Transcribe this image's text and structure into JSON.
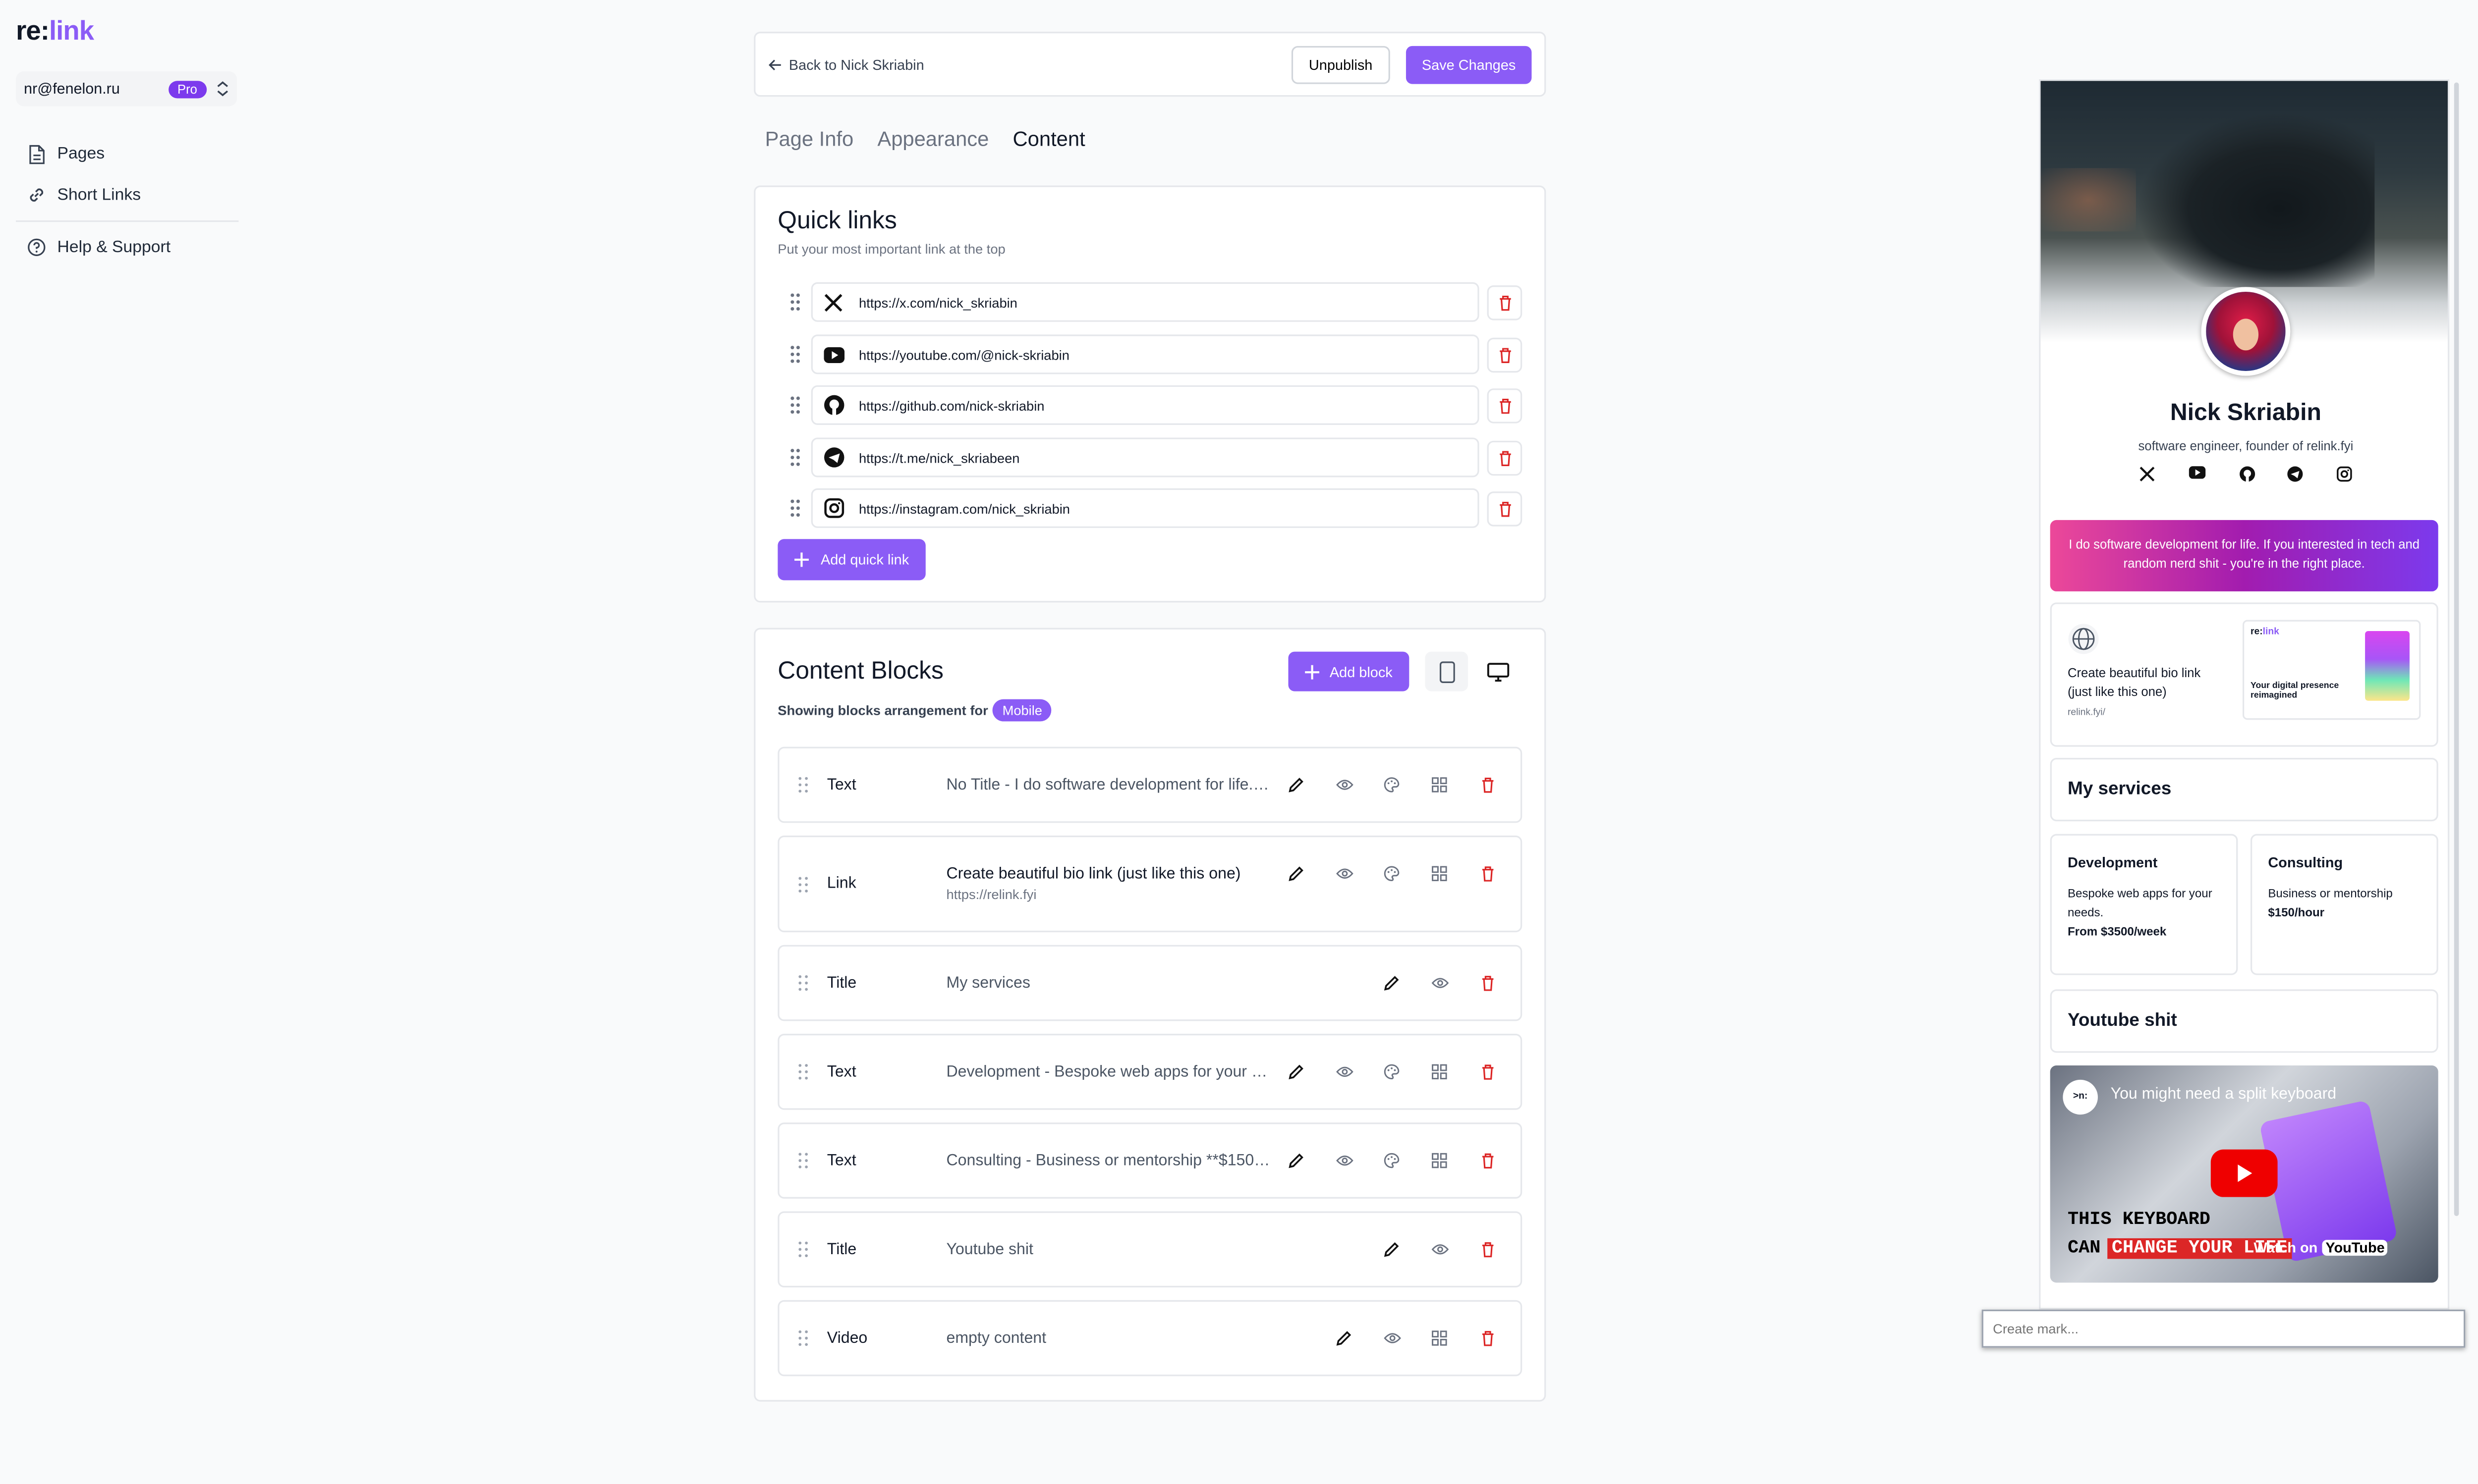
{
  "brand": {
    "re": "re:",
    "link": "link"
  },
  "account": {
    "email": "nr@fenelon.ru",
    "plan": "Pro"
  },
  "sidebar": {
    "items": [
      {
        "label": "Pages",
        "icon": "file-icon"
      },
      {
        "label": "Short Links",
        "icon": "link-icon"
      },
      {
        "label": "Help & Support",
        "icon": "help-circle-icon"
      }
    ]
  },
  "topbar": {
    "back_label": "Back to Nick Skriabin",
    "unpublish_label": "Unpublish",
    "save_label": "Save Changes"
  },
  "tabs": [
    {
      "label": "Page Info",
      "active": false
    },
    {
      "label": "Appearance",
      "active": false
    },
    {
      "label": "Content",
      "active": true
    }
  ],
  "quick_links": {
    "title": "Quick links",
    "subtitle": "Put your most important link at the top",
    "items": [
      {
        "icon": "x-icon",
        "url": "https://x.com/nick_skriabin"
      },
      {
        "icon": "youtube-icon",
        "url": "https://youtube.com/@nick-skriabin"
      },
      {
        "icon": "github-icon",
        "url": "https://github.com/nick-skriabin"
      },
      {
        "icon": "telegram-icon",
        "url": "https://t.me/nick_skriabeen"
      },
      {
        "icon": "instagram-icon",
        "url": "https://instagram.com/nick_skriabin"
      }
    ],
    "add_label": "Add quick link"
  },
  "content_blocks": {
    "title": "Content Blocks",
    "subtitle": "Showing blocks arrangement for",
    "mode": "Mobile",
    "add_label": "Add block",
    "blocks": [
      {
        "type": "Text",
        "description": "No Title - I do software development for life. If you interested in tech and random nerd shit - you're in the right place."
      },
      {
        "type": "Link",
        "description": "Create beautiful bio link (just like this one)",
        "url": "https://relink.fyi"
      },
      {
        "type": "Title",
        "description": "My services"
      },
      {
        "type": "Text",
        "description": "Development - Bespoke web apps for your needs."
      },
      {
        "type": "Text",
        "description": "Consulting - Business or mentorship **$150/hour**"
      },
      {
        "type": "Title",
        "description": "Youtube shit"
      },
      {
        "type": "Video",
        "description": "empty content"
      }
    ]
  },
  "preview": {
    "name": "Nick Skriabin",
    "bio": "software engineer, founder of relink.fyi",
    "banner_text": "I do software development for life. If you interested in tech and random nerd shit - you're in the right place.",
    "link_card": {
      "title": "Create beautiful bio link (just like this one)",
      "url": "relink.fyi/",
      "thumb_logo_re": "re:",
      "thumb_logo_link": "link",
      "thumb_tagline": "Your digital presence reimagined"
    },
    "services_title": "My services",
    "services": [
      {
        "title": "Development",
        "desc": "Bespoke web apps for your needs.",
        "price": "From $3500/week"
      },
      {
        "title": "Consulting",
        "desc": "Business or mentorship",
        "price": "$150/hour"
      }
    ],
    "video_section_title": "Youtube shit",
    "video": {
      "channel": ">n:",
      "title": "You might need a split keyboard",
      "caption_line1": "THIS KEYBOARD",
      "caption_line2a": "CAN",
      "caption_line2b": "CHANGE YOUR LIFE",
      "watch_on": "Watch on",
      "watch_brand": "YouTube"
    }
  },
  "mark_input": {
    "placeholder": "Create mark..."
  },
  "colors": {
    "accent": "#8b5cf6",
    "delete": "#dc2626",
    "banner_start": "#ec4899",
    "banner_end": "#7c3aed"
  }
}
